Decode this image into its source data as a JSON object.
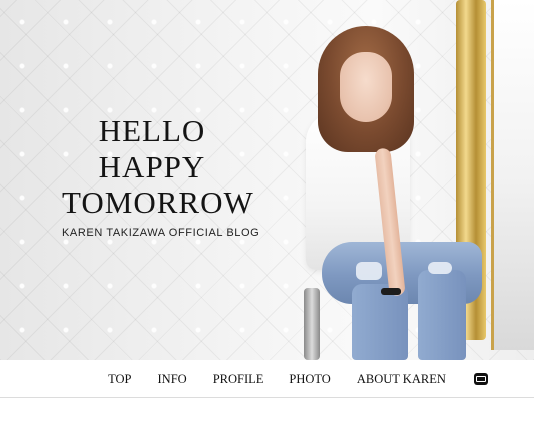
{
  "hero": {
    "title_lines": [
      "HELLO",
      "HAPPY",
      "TOMORROW"
    ],
    "subtitle": "KAREN TAKIZAWA OFFICIAL BLOG"
  },
  "nav": {
    "items": [
      {
        "label": "TOP"
      },
      {
        "label": "INFO"
      },
      {
        "label": "PROFILE"
      },
      {
        "label": "PHOTO"
      },
      {
        "label": "ABOUT KAREN"
      }
    ],
    "mail_icon": "mail-icon"
  }
}
